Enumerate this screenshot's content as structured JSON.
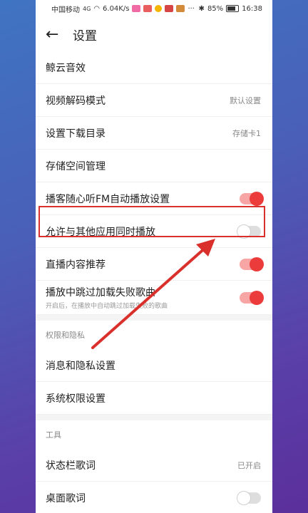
{
  "status": {
    "carrier": "中国移动",
    "signal": "4G",
    "speed": "6.04K/s",
    "battery": "85%",
    "time": "16:38"
  },
  "header": {
    "back_icon": "arrow-left-icon",
    "title": "设置"
  },
  "rows": [
    {
      "label": "鲸云音效"
    },
    {
      "label": "视频解码模式",
      "value": "默认设置"
    },
    {
      "label": "设置下载目录",
      "value": "存储卡1"
    },
    {
      "label": "存储空间管理"
    },
    {
      "label": "播客随心听FM自动播放设置",
      "toggle": "on"
    },
    {
      "label": "允许与其他应用同时播放",
      "toggle": "off"
    },
    {
      "label": "直播内容推荐",
      "toggle": "on"
    },
    {
      "label": "播放中跳过加载失败歌曲",
      "sub": "开启后，在播放中自动跳过加载失败的歌曲",
      "toggle": "on"
    }
  ],
  "section_privacy": {
    "title": "权限和隐私",
    "rows": [
      {
        "label": "消息和隐私设置"
      },
      {
        "label": "系统权限设置"
      }
    ]
  },
  "section_tools": {
    "title": "工具",
    "rows": [
      {
        "label": "状态栏歌词",
        "value": "已开启"
      },
      {
        "label": "桌面歌词",
        "toggle": "off"
      }
    ]
  },
  "colors": {
    "accent": "#ec3b3b",
    "highlight_border": "#d9302b"
  }
}
